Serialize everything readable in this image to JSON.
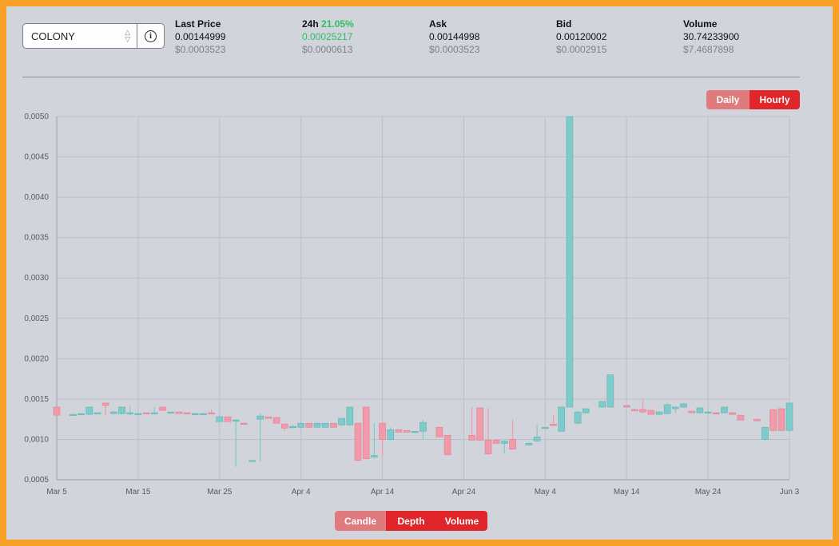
{
  "selector": {
    "value": "COLONY",
    "chevron_icon": "chevron-updown-icon"
  },
  "info_icon": "info-circle-icon",
  "stats": {
    "last_price": {
      "label": "Last Price",
      "value": "0.00144999",
      "usd": "$0.0003523"
    },
    "change_24h": {
      "label": "24h",
      "percent": "21.05%",
      "value": "0.00025217",
      "usd": "$0.0000613"
    },
    "ask": {
      "label": "Ask",
      "value": "0.00144998",
      "usd": "$0.0003523"
    },
    "bid": {
      "label": "Bid",
      "value": "0.00120002",
      "usd": "$0.0002915"
    },
    "volume": {
      "label": "Volume",
      "value": "30.74233900",
      "usd": "$7.4687898"
    }
  },
  "interval": {
    "daily": "Daily",
    "hourly": "Hourly",
    "active": "Hourly"
  },
  "view": {
    "candle": "Candle",
    "depth": "Depth",
    "volume": "Volume"
  },
  "colors": {
    "up": "#7ecbcb",
    "down": "#f29aa9",
    "active": "#e0262b",
    "inactive": "#df7a7d",
    "frame": "#f7a128"
  },
  "chart_data": {
    "type": "candlestick",
    "title": "",
    "xlabel": "",
    "ylabel": "",
    "ylim": [
      0.0005,
      0.005
    ],
    "y_ticks": [
      "0,0005",
      "0,0010",
      "0,0015",
      "0,0020",
      "0,0025",
      "0,0030",
      "0,0035",
      "0,0040",
      "0,0045",
      "0,0050"
    ],
    "x_ticks": [
      "Mar 5",
      "Mar 15",
      "Mar 25",
      "Apr 4",
      "Apr 14",
      "Apr 24",
      "May 4",
      "May 14",
      "May 24",
      "Jun 3"
    ],
    "x_range": [
      "2019-03-05",
      "2019-06-03"
    ],
    "grid": true,
    "candles": [
      {
        "date": "2019-03-05",
        "open": 0.0014,
        "high": 0.0014,
        "low": 0.0013,
        "close": 0.0013
      },
      {
        "date": "2019-03-07",
        "open": 0.00131,
        "high": 0.00132,
        "low": 0.00131,
        "close": 0.00131
      },
      {
        "date": "2019-03-08",
        "open": 0.00131,
        "high": 0.00132,
        "low": 0.00131,
        "close": 0.00132
      },
      {
        "date": "2019-03-09",
        "open": 0.00131,
        "high": 0.0014,
        "low": 0.0013,
        "close": 0.0014
      },
      {
        "date": "2019-03-10",
        "open": 0.00132,
        "high": 0.00133,
        "low": 0.00132,
        "close": 0.00133
      },
      {
        "date": "2019-03-11",
        "open": 0.00145,
        "high": 0.00145,
        "low": 0.0013,
        "close": 0.00142
      },
      {
        "date": "2019-03-12",
        "open": 0.00132,
        "high": 0.00135,
        "low": 0.00131,
        "close": 0.00134
      },
      {
        "date": "2019-03-13",
        "open": 0.00132,
        "high": 0.0014,
        "low": 0.00131,
        "close": 0.0014
      },
      {
        "date": "2019-03-14",
        "open": 0.00132,
        "high": 0.00142,
        "low": 0.0013,
        "close": 0.00133
      },
      {
        "date": "2019-03-15",
        "open": 0.00132,
        "high": 0.00133,
        "low": 0.00131,
        "close": 0.00132
      },
      {
        "date": "2019-03-16",
        "open": 0.00133,
        "high": 0.00133,
        "low": 0.00131,
        "close": 0.00132
      },
      {
        "date": "2019-03-17",
        "open": 0.00132,
        "high": 0.0014,
        "low": 0.00131,
        "close": 0.00133
      },
      {
        "date": "2019-03-18",
        "open": 0.0014,
        "high": 0.0014,
        "low": 0.00135,
        "close": 0.00136
      },
      {
        "date": "2019-03-19",
        "open": 0.00133,
        "high": 0.00134,
        "low": 0.00132,
        "close": 0.00134
      },
      {
        "date": "2019-03-20",
        "open": 0.00134,
        "high": 0.00134,
        "low": 0.00132,
        "close": 0.00132
      },
      {
        "date": "2019-03-21",
        "open": 0.00133,
        "high": 0.00133,
        "low": 0.00131,
        "close": 0.00132
      },
      {
        "date": "2019-03-22",
        "open": 0.00132,
        "high": 0.00133,
        "low": 0.00131,
        "close": 0.00132
      },
      {
        "date": "2019-03-23",
        "open": 0.00132,
        "high": 0.00133,
        "low": 0.00131,
        "close": 0.00132
      },
      {
        "date": "2019-03-24",
        "open": 0.00133,
        "high": 0.00137,
        "low": 0.00131,
        "close": 0.00132
      },
      {
        "date": "2019-03-25",
        "open": 0.00122,
        "high": 0.0013,
        "low": 0.00122,
        "close": 0.00128
      },
      {
        "date": "2019-03-26",
        "open": 0.00128,
        "high": 0.00128,
        "low": 0.00122,
        "close": 0.00122
      },
      {
        "date": "2019-03-27",
        "open": 0.00123,
        "high": 0.00125,
        "low": 0.00066,
        "close": 0.00124
      },
      {
        "date": "2019-03-28",
        "open": 0.0012,
        "high": 0.00121,
        "low": 0.00118,
        "close": 0.00119
      },
      {
        "date": "2019-03-29",
        "open": 0.00074,
        "high": 0.00074,
        "low": 0.00073,
        "close": 0.00074
      },
      {
        "date": "2019-03-30",
        "open": 0.00125,
        "high": 0.00132,
        "low": 0.00073,
        "close": 0.00129
      },
      {
        "date": "2019-03-31",
        "open": 0.00128,
        "high": 0.00128,
        "low": 0.00126,
        "close": 0.00126
      },
      {
        "date": "2019-04-01",
        "open": 0.00127,
        "high": 0.00128,
        "low": 0.0012,
        "close": 0.0012
      },
      {
        "date": "2019-04-02",
        "open": 0.00119,
        "high": 0.00119,
        "low": 0.00111,
        "close": 0.00114
      },
      {
        "date": "2019-04-03",
        "open": 0.00115,
        "high": 0.00118,
        "low": 0.00114,
        "close": 0.00116
      },
      {
        "date": "2019-04-04",
        "open": 0.00115,
        "high": 0.00121,
        "low": 0.00114,
        "close": 0.0012
      },
      {
        "date": "2019-04-05",
        "open": 0.0012,
        "high": 0.0012,
        "low": 0.00115,
        "close": 0.00115
      },
      {
        "date": "2019-04-06",
        "open": 0.00115,
        "high": 0.0012,
        "low": 0.00115,
        "close": 0.0012
      },
      {
        "date": "2019-04-07",
        "open": 0.00115,
        "high": 0.0012,
        "low": 0.00115,
        "close": 0.0012
      },
      {
        "date": "2019-04-08",
        "open": 0.0012,
        "high": 0.0012,
        "low": 0.00115,
        "close": 0.00115
      },
      {
        "date": "2019-04-09",
        "open": 0.00118,
        "high": 0.00126,
        "low": 0.00117,
        "close": 0.00126
      },
      {
        "date": "2019-04-10",
        "open": 0.00118,
        "high": 0.0014,
        "low": 0.00117,
        "close": 0.0014
      },
      {
        "date": "2019-04-11",
        "open": 0.0012,
        "high": 0.0012,
        "low": 0.00072,
        "close": 0.00074
      },
      {
        "date": "2019-04-12",
        "open": 0.0014,
        "high": 0.0014,
        "low": 0.00076,
        "close": 0.00076
      },
      {
        "date": "2019-04-13",
        "open": 0.00078,
        "high": 0.0012,
        "low": 0.00077,
        "close": 0.0008
      },
      {
        "date": "2019-04-14",
        "open": 0.0012,
        "high": 0.0012,
        "low": 0.00079,
        "close": 0.001
      },
      {
        "date": "2019-04-15",
        "open": 0.001,
        "high": 0.00115,
        "low": 0.00099,
        "close": 0.00112
      },
      {
        "date": "2019-04-16",
        "open": 0.00112,
        "high": 0.00112,
        "low": 0.00109,
        "close": 0.00109
      },
      {
        "date": "2019-04-17",
        "open": 0.00111,
        "high": 0.00111,
        "low": 0.00109,
        "close": 0.00109
      },
      {
        "date": "2019-04-18",
        "open": 0.00109,
        "high": 0.0011,
        "low": 0.00108,
        "close": 0.0011
      },
      {
        "date": "2019-04-19",
        "open": 0.0011,
        "high": 0.00125,
        "low": 0.001,
        "close": 0.00121
      },
      {
        "date": "2019-04-21",
        "open": 0.00115,
        "high": 0.00115,
        "low": 0.00103,
        "close": 0.00103
      },
      {
        "date": "2019-04-22",
        "open": 0.00105,
        "high": 0.00105,
        "low": 0.0008,
        "close": 0.00081
      },
      {
        "date": "2019-04-25",
        "open": 0.00105,
        "high": 0.0014,
        "low": 0.00099,
        "close": 0.00099
      },
      {
        "date": "2019-04-26",
        "open": 0.00139,
        "high": 0.0014,
        "low": 0.00098,
        "close": 0.00099
      },
      {
        "date": "2019-04-27",
        "open": 0.00099,
        "high": 0.00139,
        "low": 0.00081,
        "close": 0.00082
      },
      {
        "date": "2019-04-28",
        "open": 0.00099,
        "high": 0.001,
        "low": 0.00095,
        "close": 0.00095
      },
      {
        "date": "2019-04-29",
        "open": 0.00095,
        "high": 0.00099,
        "low": 0.00083,
        "close": 0.00098
      },
      {
        "date": "2019-04-30",
        "open": 0.001,
        "high": 0.00125,
        "low": 0.00087,
        "close": 0.00088
      },
      {
        "date": "2019-05-02",
        "open": 0.00093,
        "high": 0.00096,
        "low": 0.00093,
        "close": 0.00095
      },
      {
        "date": "2019-05-03",
        "open": 0.00098,
        "high": 0.00118,
        "low": 0.00097,
        "close": 0.00103
      },
      {
        "date": "2019-05-04",
        "open": 0.00114,
        "high": 0.00115,
        "low": 0.00113,
        "close": 0.00115
      },
      {
        "date": "2019-05-05",
        "open": 0.00119,
        "high": 0.0013,
        "low": 0.00117,
        "close": 0.00117
      },
      {
        "date": "2019-05-06",
        "open": 0.0011,
        "high": 0.0014,
        "low": 0.0011,
        "close": 0.0014
      },
      {
        "date": "2019-05-07",
        "open": 0.0014,
        "high": 0.005,
        "low": 0.0014,
        "close": 0.005
      },
      {
        "date": "2019-05-08",
        "open": 0.0012,
        "high": 0.00135,
        "low": 0.00119,
        "close": 0.00134
      },
      {
        "date": "2019-05-09",
        "open": 0.00133,
        "high": 0.00138,
        "low": 0.00132,
        "close": 0.00138
      },
      {
        "date": "2019-05-11",
        "open": 0.0014,
        "high": 0.00147,
        "low": 0.00139,
        "close": 0.00147
      },
      {
        "date": "2019-05-12",
        "open": 0.0014,
        "high": 0.0018,
        "low": 0.0014,
        "close": 0.0018
      },
      {
        "date": "2019-05-14",
        "open": 0.00142,
        "high": 0.00143,
        "low": 0.00139,
        "close": 0.0014
      },
      {
        "date": "2019-05-15",
        "open": 0.00137,
        "high": 0.00138,
        "low": 0.00135,
        "close": 0.00136
      },
      {
        "date": "2019-05-16",
        "open": 0.00137,
        "high": 0.00149,
        "low": 0.00133,
        "close": 0.00134
      },
      {
        "date": "2019-05-17",
        "open": 0.00136,
        "high": 0.00136,
        "low": 0.00131,
        "close": 0.00131
      },
      {
        "date": "2019-05-18",
        "open": 0.00131,
        "high": 0.00135,
        "low": 0.0013,
        "close": 0.00134
      },
      {
        "date": "2019-05-19",
        "open": 0.00132,
        "high": 0.00145,
        "low": 0.00131,
        "close": 0.00143
      },
      {
        "date": "2019-05-20",
        "open": 0.00138,
        "high": 0.00141,
        "low": 0.00133,
        "close": 0.0014
      },
      {
        "date": "2019-05-21",
        "open": 0.0014,
        "high": 0.00144,
        "low": 0.00139,
        "close": 0.00144
      },
      {
        "date": "2019-05-22",
        "open": 0.00135,
        "high": 0.00135,
        "low": 0.00133,
        "close": 0.00133
      },
      {
        "date": "2019-05-23",
        "open": 0.00133,
        "high": 0.0014,
        "low": 0.00132,
        "close": 0.00139
      },
      {
        "date": "2019-05-24",
        "open": 0.00133,
        "high": 0.00135,
        "low": 0.00132,
        "close": 0.00134
      },
      {
        "date": "2019-05-25",
        "open": 0.00133,
        "high": 0.00134,
        "low": 0.00132,
        "close": 0.00132
      },
      {
        "date": "2019-05-26",
        "open": 0.00133,
        "high": 0.0014,
        "low": 0.00132,
        "close": 0.0014
      },
      {
        "date": "2019-05-27",
        "open": 0.00133,
        "high": 0.00134,
        "low": 0.00132,
        "close": 0.00131
      },
      {
        "date": "2019-05-28",
        "open": 0.0013,
        "high": 0.0013,
        "low": 0.00124,
        "close": 0.00124
      },
      {
        "date": "2019-05-30",
        "open": 0.00125,
        "high": 0.00125,
        "low": 0.00123,
        "close": 0.00123
      },
      {
        "date": "2019-05-31",
        "open": 0.001,
        "high": 0.00115,
        "low": 0.00099,
        "close": 0.00115
      },
      {
        "date": "2019-06-01",
        "open": 0.00137,
        "high": 0.00138,
        "low": 0.0011,
        "close": 0.00111
      },
      {
        "date": "2019-06-02",
        "open": 0.00138,
        "high": 0.00139,
        "low": 0.0011,
        "close": 0.00111
      },
      {
        "date": "2019-06-03",
        "open": 0.00111,
        "high": 0.00145,
        "low": 0.0011,
        "close": 0.00145
      }
    ]
  }
}
